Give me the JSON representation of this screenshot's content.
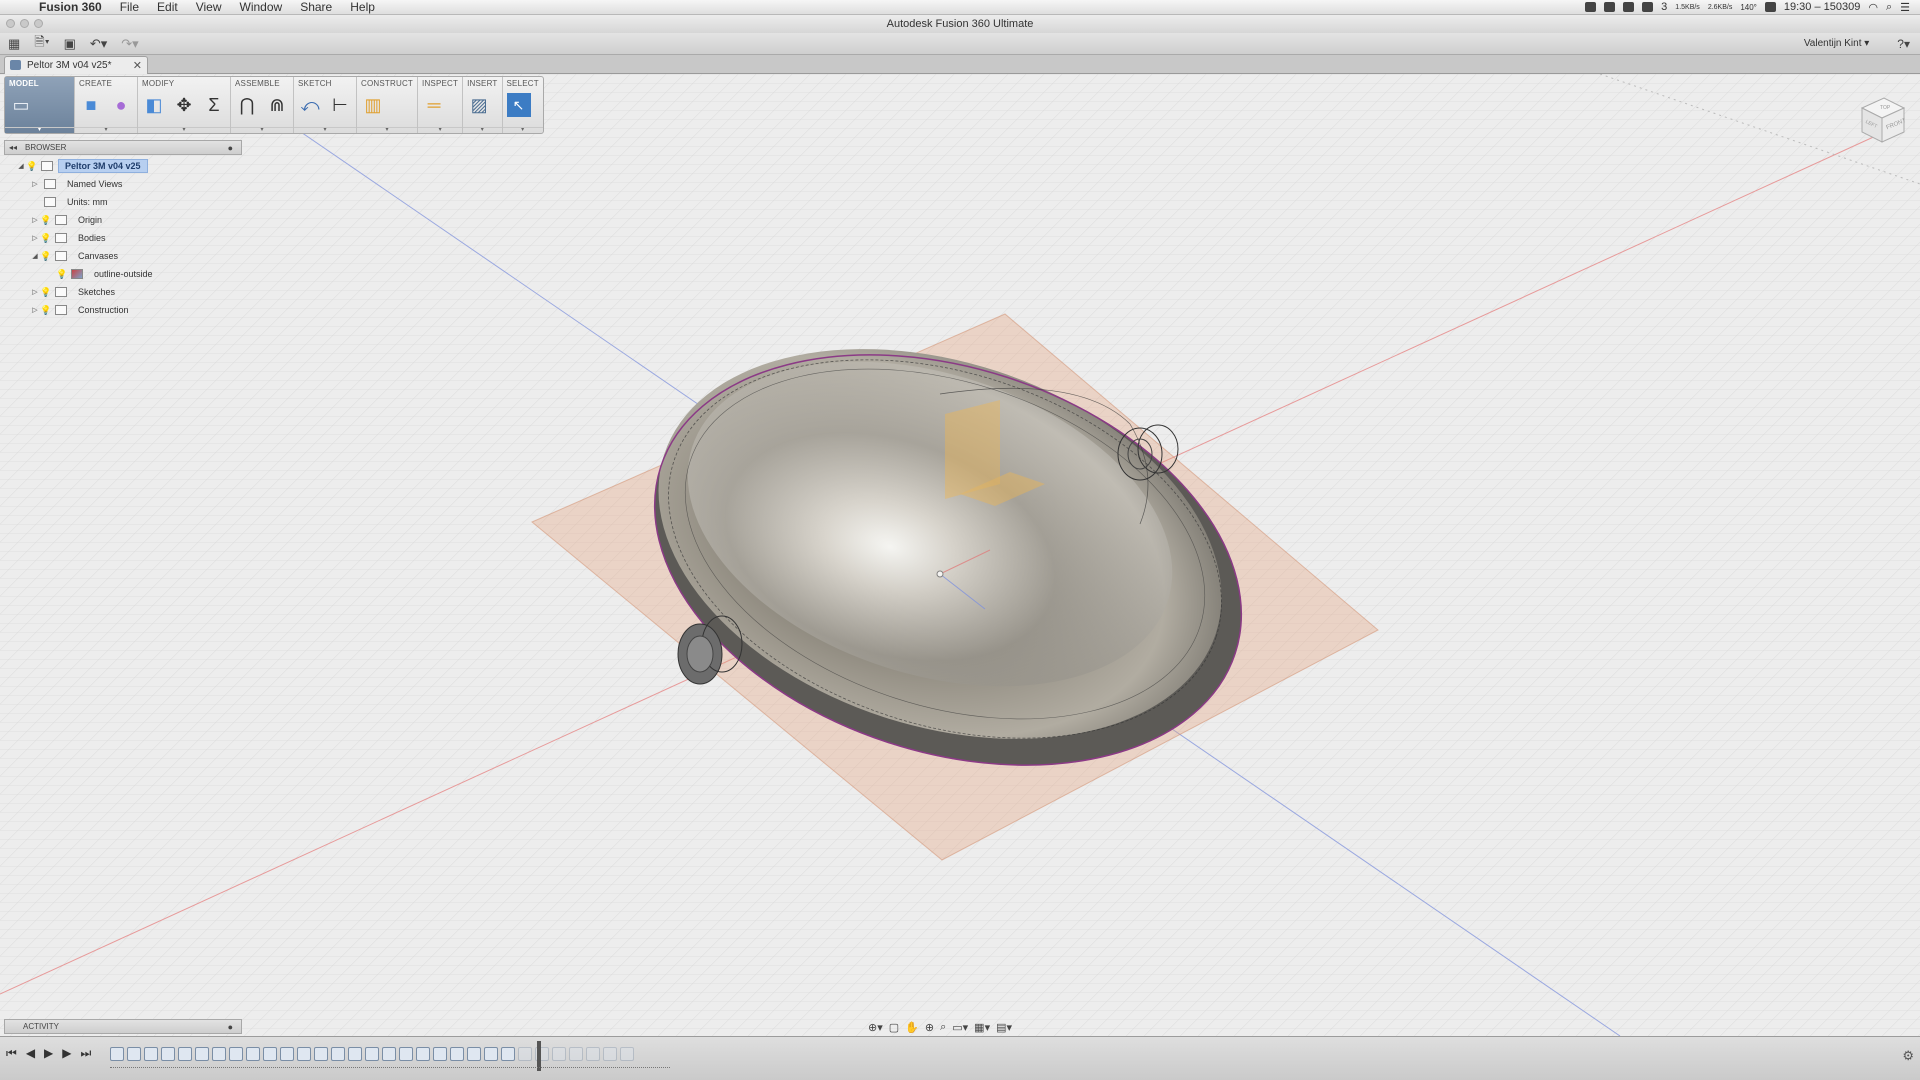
{
  "menubar": {
    "app_name": "Fusion 360",
    "menus": [
      "File",
      "Edit",
      "View",
      "Window",
      "Share",
      "Help"
    ],
    "clock": "19:30 – 150309",
    "net_up": "1.5KB/s",
    "net_down": "2.6KB/s",
    "temp": "140°",
    "battery_count": "3"
  },
  "window": {
    "title": "Autodesk Fusion 360 Ultimate"
  },
  "toolbar": {
    "user_name": "Valentijn Kint ▾",
    "help_label": "?▾"
  },
  "document_tab": {
    "title": "Peltor 3M v04 v25*",
    "close": "✕"
  },
  "ribbon": {
    "workspace": "MODEL",
    "groups": [
      "CREATE",
      "MODIFY",
      "ASSEMBLE",
      "SKETCH",
      "CONSTRUCT",
      "INSPECT",
      "INSERT",
      "SELECT"
    ]
  },
  "browser": {
    "header": "BROWSER",
    "nodes": [
      {
        "label": "Peltor 3M v04 v25",
        "level": 0,
        "expanded": true,
        "selected": true,
        "icon": "component-icon"
      },
      {
        "label": "Named Views",
        "level": 1,
        "expanded": false,
        "icon": "folder-icon"
      },
      {
        "label": "Units: mm",
        "level": 1,
        "expanded": false,
        "icon": "document-icon"
      },
      {
        "label": "Origin",
        "level": 1,
        "expanded": false,
        "icon": "folder-icon"
      },
      {
        "label": "Bodies",
        "level": 1,
        "expanded": false,
        "icon": "folder-icon"
      },
      {
        "label": "Canvases",
        "level": 1,
        "expanded": true,
        "icon": "folder-icon"
      },
      {
        "label": "outline-outside",
        "level": 2,
        "expanded": false,
        "icon": "image-icon"
      },
      {
        "label": "Sketches",
        "level": 1,
        "expanded": false,
        "icon": "folder-icon"
      },
      {
        "label": "Construction",
        "level": 1,
        "expanded": false,
        "icon": "folder-icon"
      }
    ]
  },
  "viewcube": {
    "faces": [
      "TOP",
      "FRONT",
      "LEFT"
    ]
  },
  "activity": {
    "header": "ACTIVITY"
  },
  "colors": {
    "accent": "#6c829b",
    "selection": "#b7cff0",
    "canvas": "#e8b090",
    "body": "#a39e90"
  }
}
